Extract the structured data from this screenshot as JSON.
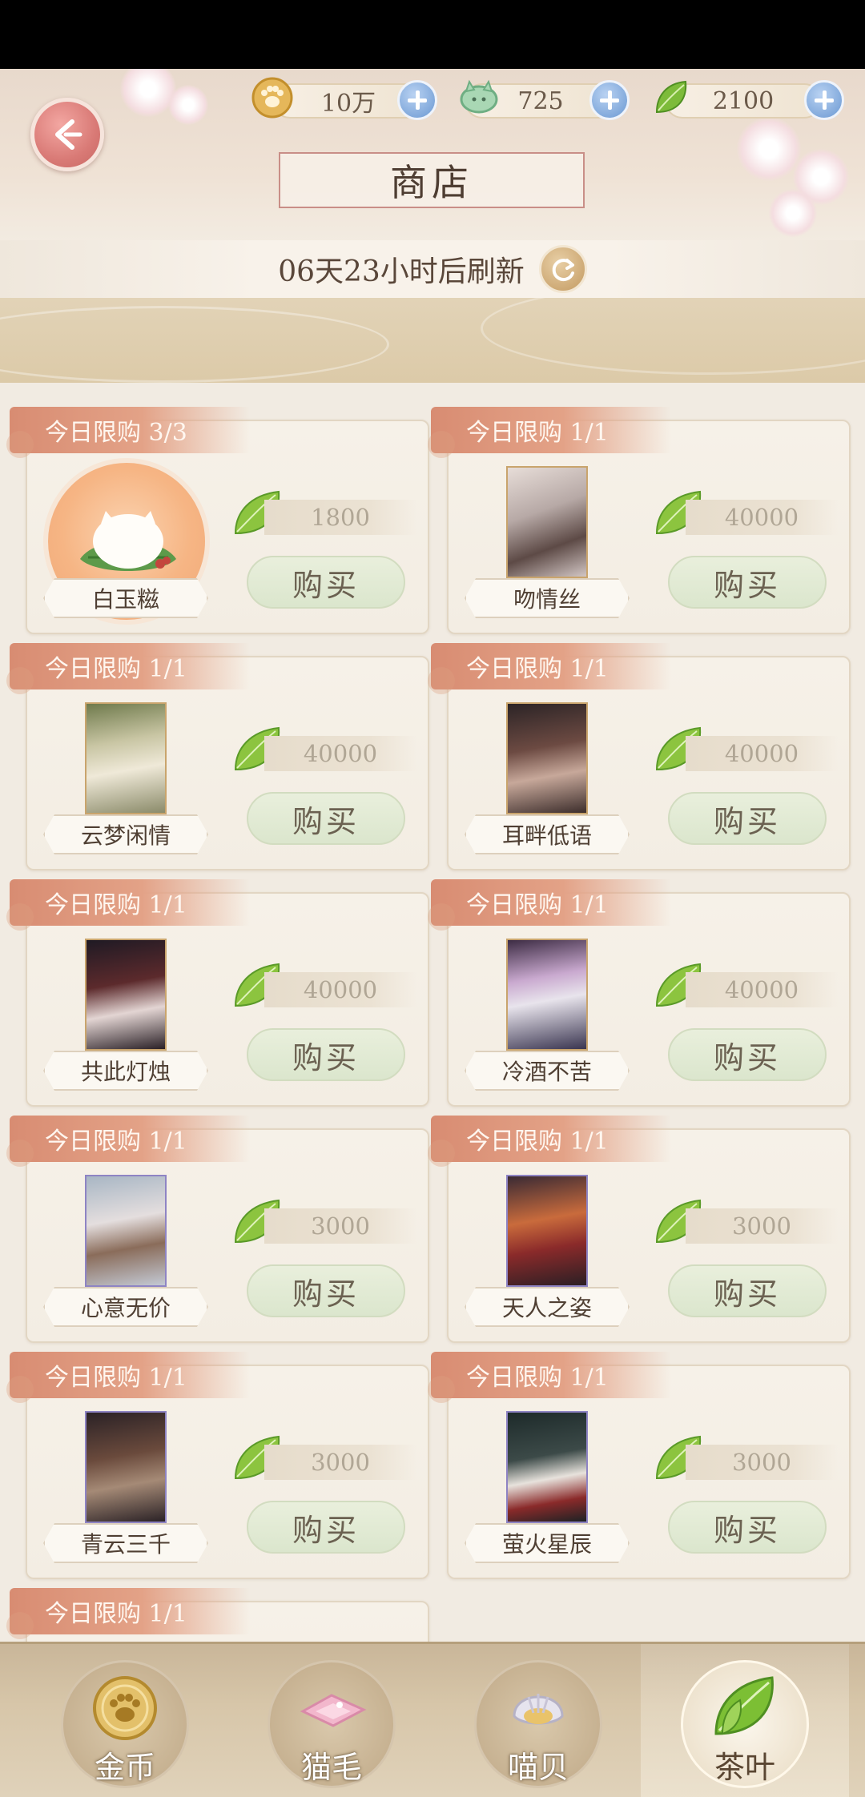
{
  "header": {
    "title": "商店",
    "refresh_text": "06天23小时后刷新"
  },
  "currencies": [
    {
      "icon": "paw-coin-icon",
      "value": "10万"
    },
    {
      "icon": "cat-hair-icon",
      "value": "725"
    },
    {
      "icon": "tea-leaf-icon",
      "value": "2100"
    }
  ],
  "items": [
    {
      "limit": "今日限购 3/3",
      "name": "白玉糍",
      "price": "1800",
      "buy": "购买",
      "image": "rice-cake"
    },
    {
      "limit": "今日限购 1/1",
      "name": "吻情丝",
      "price": "40000",
      "buy": "购买",
      "image": "card-art"
    },
    {
      "limit": "今日限购 1/1",
      "name": "云梦闲情",
      "price": "40000",
      "buy": "购买",
      "image": "card-art"
    },
    {
      "limit": "今日限购 1/1",
      "name": "耳畔低语",
      "price": "40000",
      "buy": "购买",
      "image": "card-art"
    },
    {
      "limit": "今日限购 1/1",
      "name": "共此灯烛",
      "price": "40000",
      "buy": "购买",
      "image": "card-art"
    },
    {
      "limit": "今日限购 1/1",
      "name": "冷酒不苦",
      "price": "40000",
      "buy": "购买",
      "image": "card-art"
    },
    {
      "limit": "今日限购 1/1",
      "name": "心意无价",
      "price": "3000",
      "buy": "购买",
      "image": "card-art"
    },
    {
      "limit": "今日限购 1/1",
      "name": "天人之姿",
      "price": "3000",
      "buy": "购买",
      "image": "card-art"
    },
    {
      "limit": "今日限购 1/1",
      "name": "青云三千",
      "price": "3000",
      "buy": "购买",
      "image": "card-art"
    },
    {
      "limit": "今日限购 1/1",
      "name": "萤火星辰",
      "price": "3000",
      "buy": "购买",
      "image": "card-art"
    },
    {
      "limit": "今日限购 1/1"
    }
  ],
  "nav": [
    {
      "label": "金币",
      "icon": "gold-coin-icon",
      "active": false
    },
    {
      "label": "猫毛",
      "icon": "cat-hair-icon",
      "active": false
    },
    {
      "label": "喵贝",
      "icon": "shell-icon",
      "active": false
    },
    {
      "label": "茶叶",
      "icon": "tea-leaf-icon",
      "active": true
    }
  ],
  "colors": {
    "accent_tag": "#d88c72",
    "buy_button": "#dbe6cd",
    "background": "#f1ebe2"
  }
}
